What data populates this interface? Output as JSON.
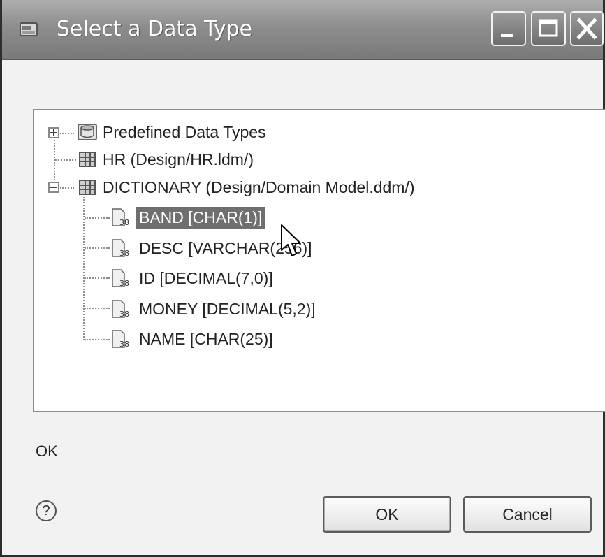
{
  "dialog": {
    "title": "Select a Data Type"
  },
  "tree": {
    "nodes": [
      {
        "label": "Predefined Data Types",
        "icon": "database-folder-icon",
        "expanded": false
      },
      {
        "label": "HR (Design/HR.ldm/)",
        "icon": "table-model-icon"
      },
      {
        "label": "DICTIONARY (Design/Domain Model.ddm/)",
        "icon": "table-model-icon",
        "expanded": true
      }
    ],
    "children": [
      {
        "label": "BAND [CHAR(1)]",
        "icon": "data-type-icon",
        "selected": true
      },
      {
        "label": "DESC [VARCHAR(256)]",
        "icon": "data-type-icon"
      },
      {
        "label": "ID [DECIMAL(7,0)]",
        "icon": "data-type-icon"
      },
      {
        "label": "MONEY [DECIMAL(5,2)]",
        "icon": "data-type-icon"
      },
      {
        "label": "NAME [CHAR(25)]",
        "icon": "data-type-icon"
      }
    ]
  },
  "status": {
    "text": "OK"
  },
  "help": {
    "glyph": "?"
  },
  "buttons": {
    "ok_label": "OK",
    "cancel_label": "Cancel"
  },
  "colors": {
    "selection": "#6f6f6f",
    "titlebar": "#8d8d8d"
  }
}
